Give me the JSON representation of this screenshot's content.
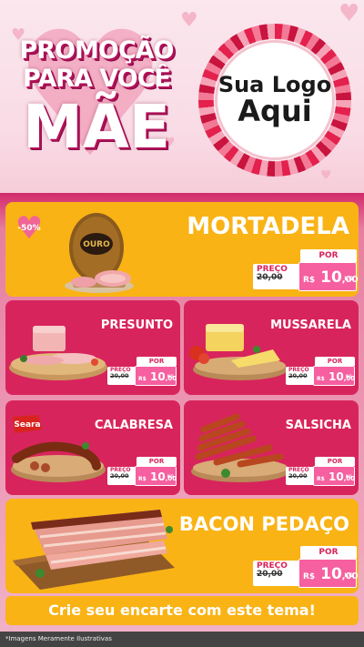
{
  "header": {
    "promo_line1": "PROMOÇÃO",
    "promo_line2": "PARA VOCÊ",
    "promo_line3": "MÃE",
    "logo_line1": "Sua Logo",
    "logo_line2": "Aqui"
  },
  "products": {
    "mortadela": {
      "name": "MORTADELA",
      "badge": "-50%",
      "brand": "OURO",
      "por": "POR",
      "preco": "PREÇO",
      "old": "20,00",
      "cur": "R$",
      "price": "10",
      "dec": ",00",
      "unit": "KG"
    },
    "presunto": {
      "name": "PRESUNTO",
      "por": "POR",
      "preco": "PREÇO",
      "old": "20,00",
      "cur": "R$",
      "price": "10",
      "dec": ",00",
      "unit": "KG"
    },
    "mussarela": {
      "name": "MUSSARELA",
      "por": "POR",
      "preco": "PREÇO",
      "old": "20,00",
      "cur": "R$",
      "price": "10",
      "dec": ",00",
      "unit": "KG"
    },
    "calabresa": {
      "name": "CALABRESA",
      "brand": "Seara",
      "por": "POR",
      "preco": "PREÇO",
      "old": "20,00",
      "cur": "R$",
      "price": "10",
      "dec": ",00",
      "unit": "KG"
    },
    "salsicha": {
      "name": "SALSICHA",
      "por": "POR",
      "preco": "PREÇO",
      "old": "20,00",
      "cur": "R$",
      "price": "10",
      "dec": ",00",
      "unit": "KG"
    },
    "bacon": {
      "name": "BACON PEDAÇO",
      "por": "POR",
      "preco": "PREÇO",
      "old": "20,00",
      "cur": "R$",
      "price": "10",
      "dec": ",00",
      "unit": "KG"
    }
  },
  "cta": "Crie seu encarte com este tema!",
  "footer": "*Imagens Meramente Ilustrativas"
}
